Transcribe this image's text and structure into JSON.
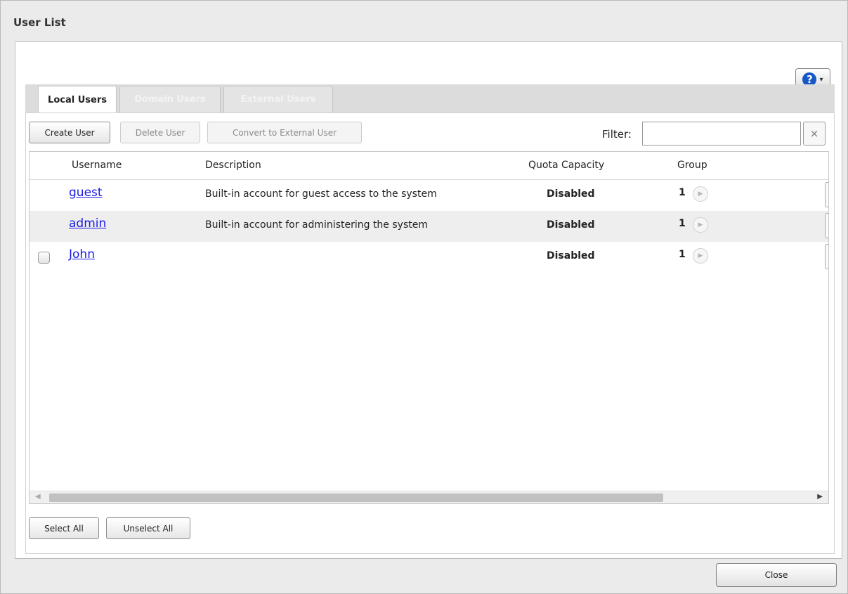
{
  "dialog": {
    "title": "User List",
    "help_icon": "question-circle-icon",
    "help_caret": "▾",
    "close_label": "Close"
  },
  "tabs": [
    {
      "label": "Local Users",
      "state": "active"
    },
    {
      "label": "Domain Users",
      "state": "disabled"
    },
    {
      "label": "External Users",
      "state": "disabled"
    }
  ],
  "toolbar": {
    "create_label": "Create User",
    "delete_label": "Delete User",
    "convert_label": "Convert to External User",
    "filter_label": "Filter:",
    "filter_value": "",
    "clear_glyph": "×"
  },
  "table": {
    "headers": {
      "username": "Username",
      "description": "Description",
      "quota": "Quota Capacity",
      "group": "Group"
    },
    "rows": [
      {
        "username": "guest",
        "description": "Built-in account for guest access to the system",
        "quota": "Disabled",
        "group_count": "1",
        "has_checkbox": false,
        "checked": false
      },
      {
        "username": "admin",
        "description": "Built-in account for administering the system",
        "quota": "Disabled",
        "group_count": "1",
        "has_checkbox": false,
        "checked": false
      },
      {
        "username": "John",
        "description": "",
        "quota": "Disabled",
        "group_count": "1",
        "has_checkbox": true,
        "checked": false
      }
    ]
  },
  "footer": {
    "select_all_label": "Select All",
    "unselect_all_label": "Unselect All"
  },
  "icons": {
    "group_arrow": "▶",
    "scroll_left": "◀",
    "scroll_right": "▶"
  },
  "colors": {
    "link": "#1a1ae6",
    "help_icon": "#1658c8"
  }
}
